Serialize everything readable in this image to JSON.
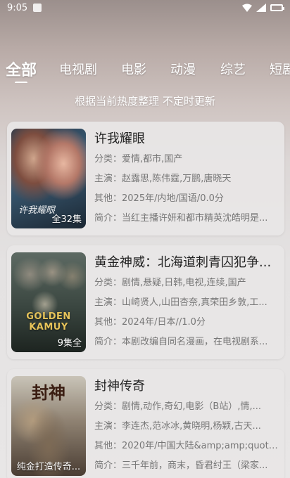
{
  "status_bar": {
    "time": "9:05"
  },
  "tabs": [
    {
      "label": "全部",
      "active": true
    },
    {
      "label": "电视剧",
      "active": false
    },
    {
      "label": "电影",
      "active": false
    },
    {
      "label": "动漫",
      "active": false
    },
    {
      "label": "综艺",
      "active": false
    },
    {
      "label": "短剧",
      "active": false
    }
  ],
  "subtitle": "根据当前热度整理 不定时更新",
  "labels": {
    "category": "分类：",
    "cast": "主演：",
    "other": "其他：",
    "intro": "简介："
  },
  "items": [
    {
      "title": "许我耀眼",
      "category": "爱情,都市,国产",
      "cast": "赵露思,陈伟霆,万鹏,唐晓天",
      "other": "2025年/内地/国语/0.0分",
      "intro": "当红主播许妍和都市精英沈皓明是...",
      "badge": "全32集",
      "poster_text": "许我耀眼"
    },
    {
      "title": "黄金神威：北海道刺青囚犯争...",
      "category": "剧情,悬疑,日韩,电视,连续,国产",
      "cast": "山崎贤人,山田杏奈,真荣田乡敦,工...",
      "other": "2024年/日本//1.0分",
      "intro": "本剧改编自同名漫画，在电视剧系...",
      "badge": "9集全",
      "poster_text": "GOLDEN KAMUY"
    },
    {
      "title": "封神传奇",
      "category": "剧情,动作,奇幻,电影（B站）,情,...",
      "cast": "李连杰,范冰冰,黄晓明,杨颖,古天...",
      "other": "2020年/中国大陆&amp;amp;quot;...",
      "intro": "三千年前，商末，昏君纣王（梁家...",
      "badge": "纯金打造传奇...",
      "poster_text": "封神"
    }
  ]
}
